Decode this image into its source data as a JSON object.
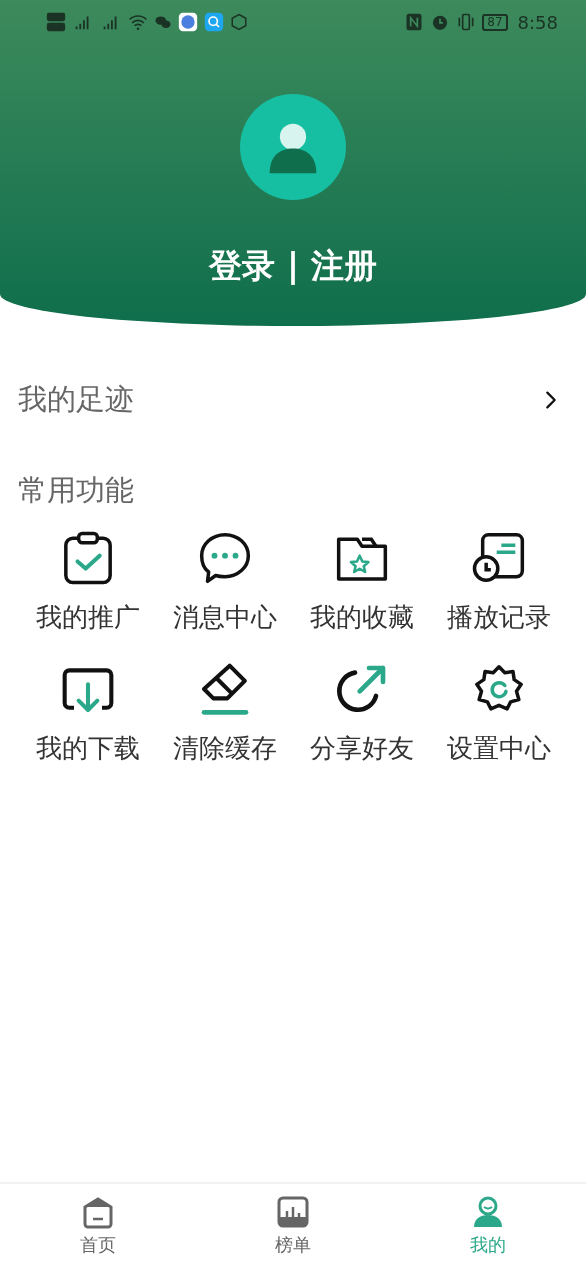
{
  "status_bar": {
    "battery": "87",
    "time": "8:58"
  },
  "header": {
    "login": "登录 | 注册"
  },
  "footprint": {
    "label": "我的足迹"
  },
  "functions": {
    "title": "常用功能",
    "items": [
      {
        "kind": "clipboard",
        "label": "我的推广"
      },
      {
        "kind": "chat",
        "label": "消息中心"
      },
      {
        "kind": "folder",
        "label": "我的收藏"
      },
      {
        "kind": "history",
        "label": "播放记录"
      },
      {
        "kind": "download",
        "label": "我的下载"
      },
      {
        "kind": "eraser",
        "label": "清除缓存"
      },
      {
        "kind": "share",
        "label": "分享好友"
      },
      {
        "kind": "gear",
        "label": "设置中心"
      }
    ]
  },
  "nav": [
    {
      "kind": "home",
      "label": "首页",
      "selected": false
    },
    {
      "kind": "chart",
      "label": "榜单",
      "selected": false
    },
    {
      "kind": "user",
      "label": "我的",
      "selected": true
    }
  ]
}
